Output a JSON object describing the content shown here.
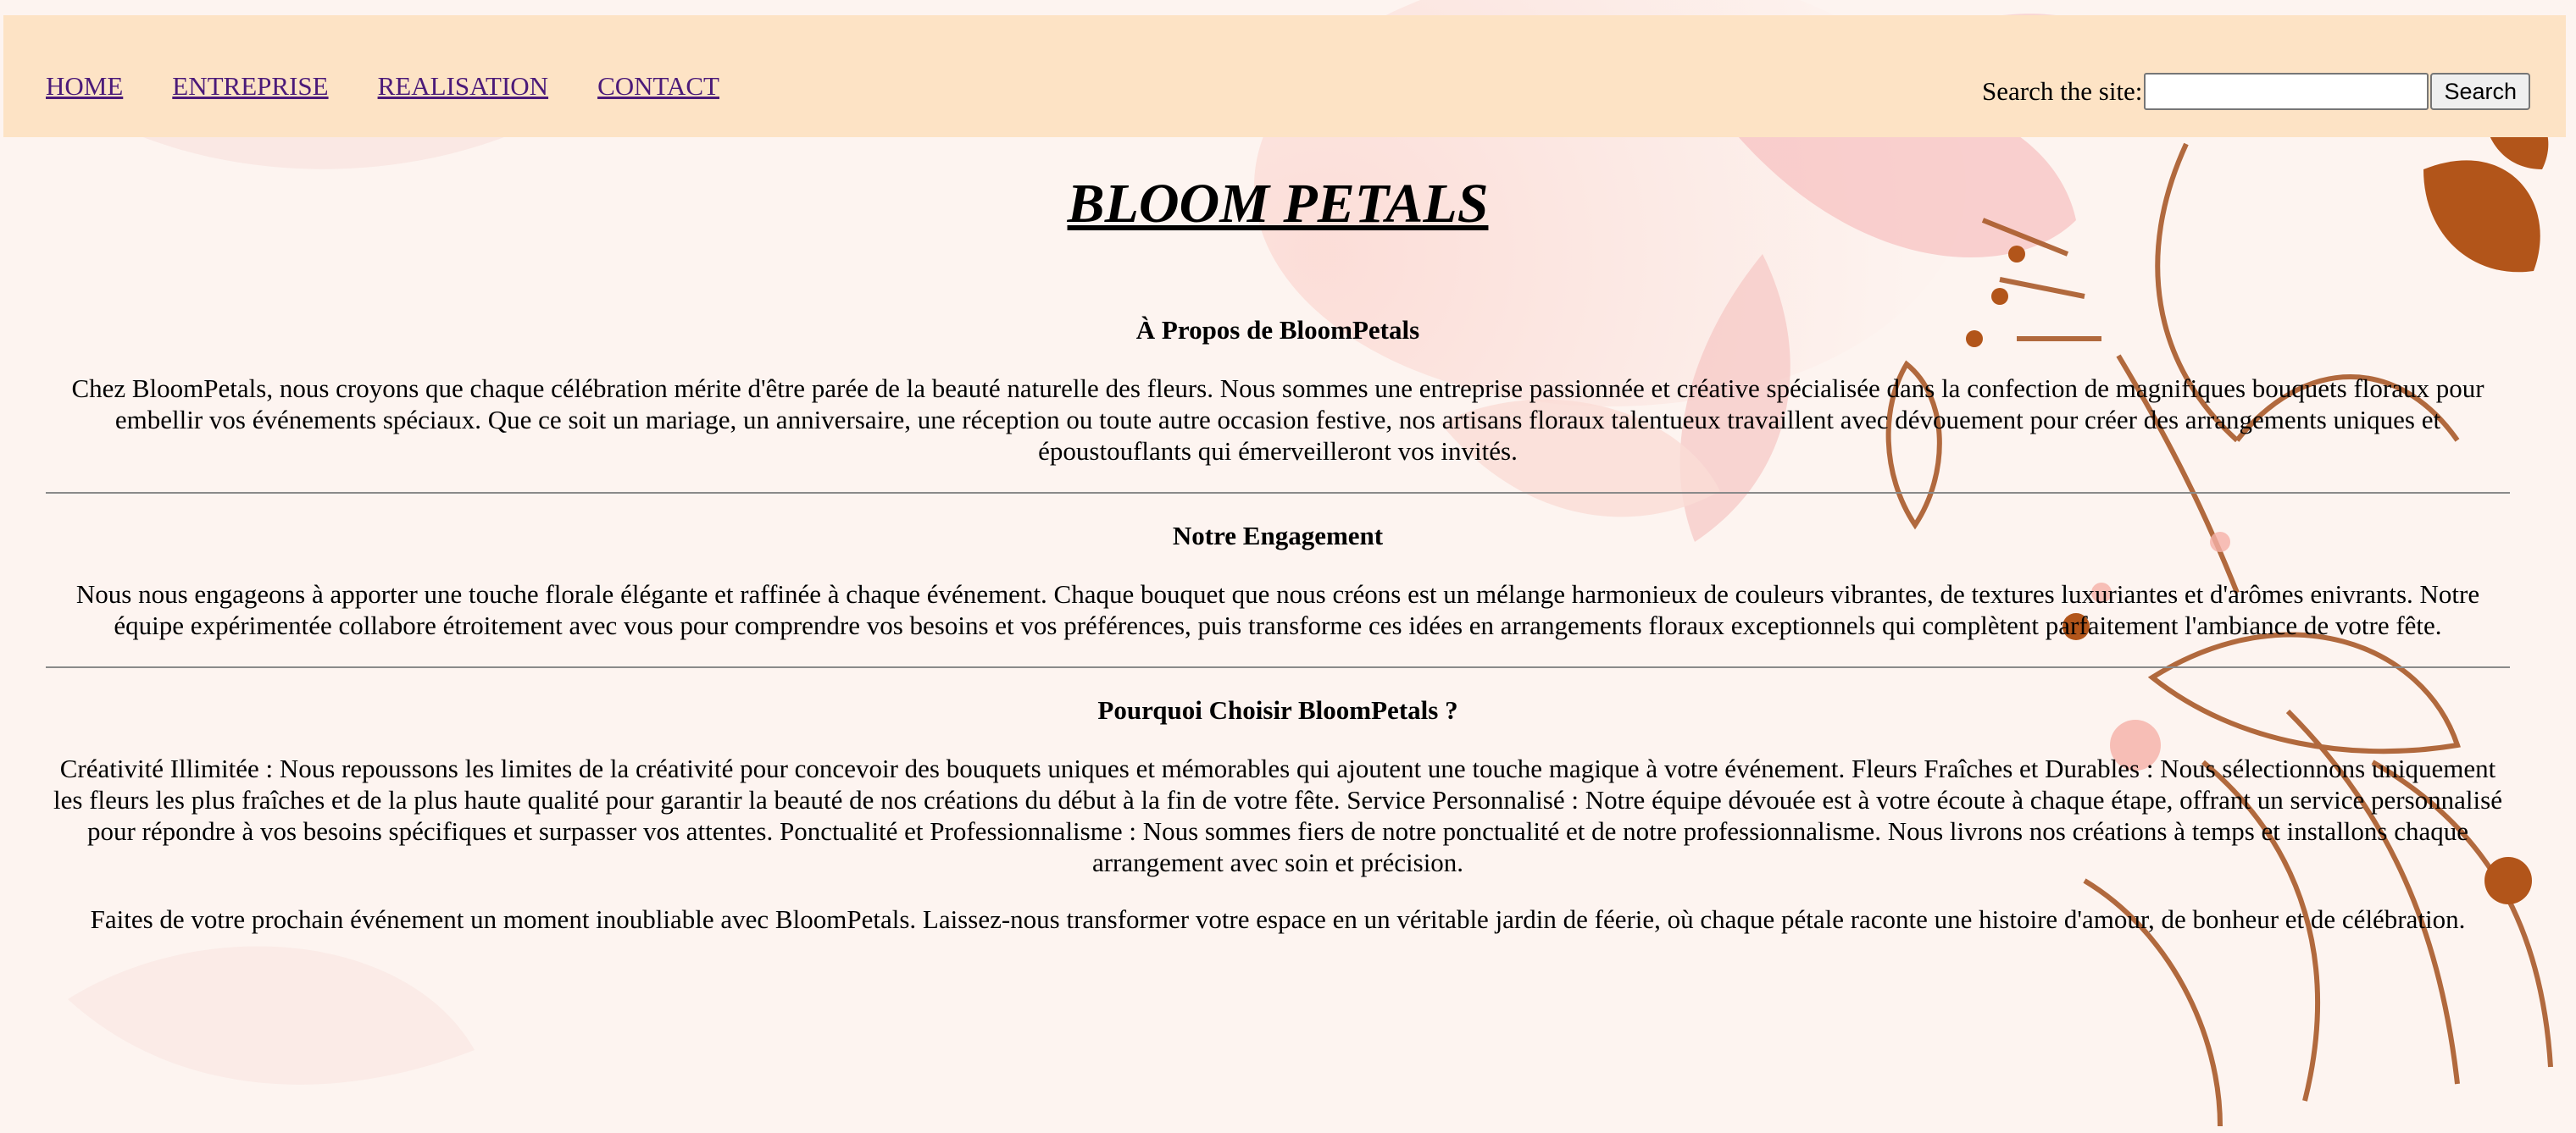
{
  "nav": {
    "items": [
      {
        "label": "HOME"
      },
      {
        "label": "ENTREPRISE"
      },
      {
        "label": "REALISATION"
      },
      {
        "label": "CONTACT"
      }
    ]
  },
  "search": {
    "label": "Search the site:",
    "value": "",
    "placeholder": "",
    "button_label": "Search"
  },
  "main": {
    "title": "BLOOM PETALS",
    "sections": [
      {
        "heading": "À Propos de BloomPetals",
        "text": "Chez BloomPetals, nous croyons que chaque célébration mérite d'être parée de la beauté naturelle des fleurs. Nous sommes une entreprise passionnée et créative spécialisée dans la confection de magnifiques bouquets floraux pour embellir vos événements spéciaux. Que ce soit un mariage, un anniversaire, une réception ou toute autre occasion festive, nos artisans floraux talentueux travaillent avec dévouement pour créer des arrangements uniques et époustouflants qui émerveilleront vos invités."
      },
      {
        "heading": "Notre Engagement",
        "text": "Nous nous engageons à apporter une touche florale élégante et raffinée à chaque événement. Chaque bouquet que nous créons est un mélange harmonieux de couleurs vibrantes, de textures luxuriantes et d'arômes enivrants. Notre équipe expérimentée collabore étroitement avec vous pour comprendre vos besoins et vos préférences, puis transforme ces idées en arrangements floraux exceptionnels qui complètent parfaitement l'ambiance de votre fête."
      },
      {
        "heading": "Pourquoi Choisir BloomPetals ?",
        "text": "Créativité Illimitée : Nous repoussons les limites de la créativité pour concevoir des bouquets uniques et mémorables qui ajoutent une touche magique à votre événement. Fleurs Fraîches et Durables : Nous sélectionnons uniquement les fleurs les plus fraîches et de la plus haute qualité pour garantir la beauté de nos créations du début à la fin de votre fête. Service Personnalisé : Notre équipe dévouée est à votre écoute à chaque étape, offrant un service personnalisé pour répondre à vos besoins spécifiques et surpasser vos attentes. Ponctualité et Professionnalisme : Nous sommes fiers de notre ponctualité et de notre professionnalisme. Nous livrons nos créations à temps et installons chaque arrangement avec soin et précision."
      }
    ],
    "closing": "Faites de votre prochain événement un moment inoubliable avec BloomPetals. Laissez-nous transformer votre espace en un véritable jardin de féerie, où chaque pétale raconte une histoire d'amour, de bonheur et de célébration."
  },
  "colors": {
    "topbar_bg": "#fde3c5",
    "link": "#4b1a79",
    "flower_brown": "#b2551a",
    "flower_pink": "#f5b6b6"
  }
}
